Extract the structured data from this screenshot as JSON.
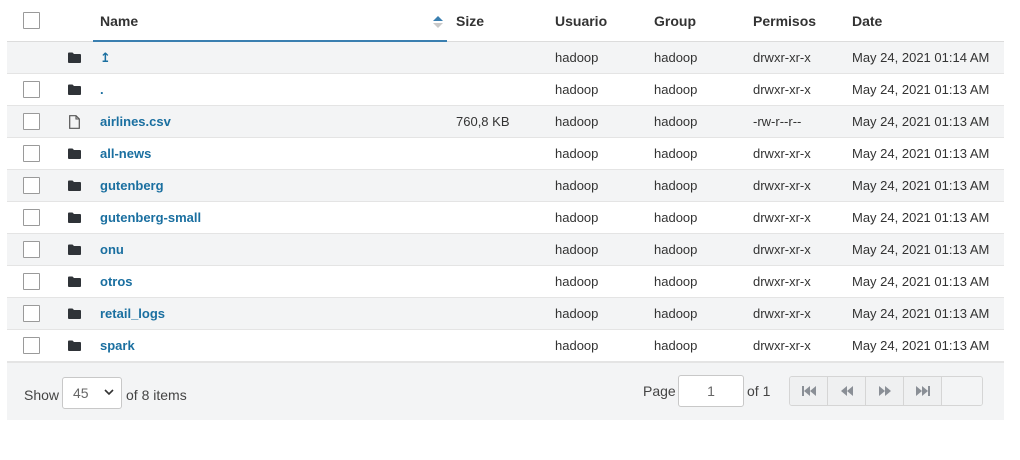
{
  "columns": {
    "name": "Name",
    "size": "Size",
    "user": "Usuario",
    "group": "Group",
    "permissions": "Permisos",
    "date": "Date"
  },
  "rows": [
    {
      "type": "parent",
      "name": "↥",
      "size": "",
      "user": "hadoop",
      "group": "hadoop",
      "permissions": "drwxr-xr-x",
      "date": "May 24, 2021 01:14 AM"
    },
    {
      "type": "folder",
      "name": ".",
      "size": "",
      "user": "hadoop",
      "group": "hadoop",
      "permissions": "drwxr-xr-x",
      "date": "May 24, 2021 01:13 AM"
    },
    {
      "type": "file",
      "name": "airlines.csv",
      "size": "760,8 KB",
      "user": "hadoop",
      "group": "hadoop",
      "permissions": "-rw-r--r--",
      "date": "May 24, 2021 01:13 AM"
    },
    {
      "type": "folder",
      "name": "all-news",
      "size": "",
      "user": "hadoop",
      "group": "hadoop",
      "permissions": "drwxr-xr-x",
      "date": "May 24, 2021 01:13 AM"
    },
    {
      "type": "folder",
      "name": "gutenberg",
      "size": "",
      "user": "hadoop",
      "group": "hadoop",
      "permissions": "drwxr-xr-x",
      "date": "May 24, 2021 01:13 AM"
    },
    {
      "type": "folder",
      "name": "gutenberg-small",
      "size": "",
      "user": "hadoop",
      "group": "hadoop",
      "permissions": "drwxr-xr-x",
      "date": "May 24, 2021 01:13 AM"
    },
    {
      "type": "folder",
      "name": "onu",
      "size": "",
      "user": "hadoop",
      "group": "hadoop",
      "permissions": "drwxr-xr-x",
      "date": "May 24, 2021 01:13 AM"
    },
    {
      "type": "folder",
      "name": "otros",
      "size": "",
      "user": "hadoop",
      "group": "hadoop",
      "permissions": "drwxr-xr-x",
      "date": "May 24, 2021 01:13 AM"
    },
    {
      "type": "folder",
      "name": "retail_logs",
      "size": "",
      "user": "hadoop",
      "group": "hadoop",
      "permissions": "drwxr-xr-x",
      "date": "May 24, 2021 01:13 AM"
    },
    {
      "type": "folder",
      "name": "spark",
      "size": "",
      "user": "hadoop",
      "group": "hadoop",
      "permissions": "drwxr-xr-x",
      "date": "May 24, 2021 01:13 AM"
    }
  ],
  "footer": {
    "show_label": "Show",
    "page_size": "45",
    "of_items": "of 8 items",
    "page_label": "Page",
    "page_value": "1",
    "of_pages": "of 1"
  },
  "icons": {
    "folder": "folder-icon",
    "file": "file-icon",
    "parent": "parent-directory-icon",
    "sort": "sort-ascending-icon",
    "first": "first-page-icon",
    "prev": "previous-page-icon",
    "next": "next-page-icon",
    "last": "last-page-icon"
  },
  "colors": {
    "link": "#1a6fa0",
    "sort_active": "#3a7fb0",
    "row_stripe": "#f3f4f5"
  }
}
